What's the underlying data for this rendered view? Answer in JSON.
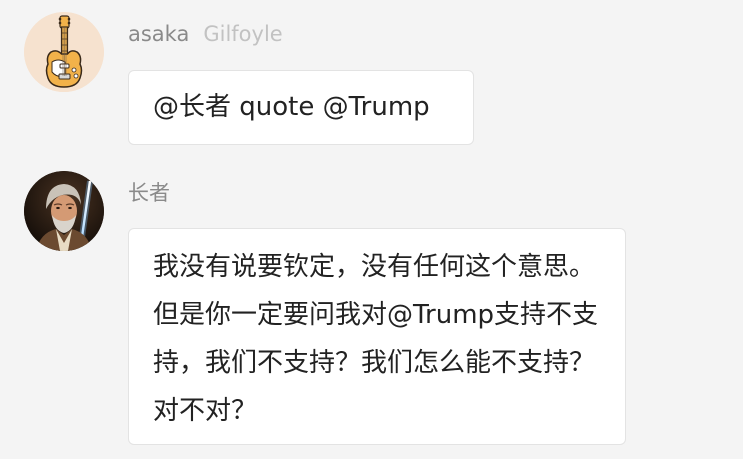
{
  "chat": {
    "messages": [
      {
        "sender": "asaka",
        "sender_tag": "Gilfoyle",
        "avatar_icon": "electric-guitar-icon",
        "text": "@长者 quote @Trump"
      },
      {
        "sender": "长者",
        "sender_tag": "",
        "avatar_icon": "jedi-portrait-avatar",
        "text": "我没有说要钦定，没有任何这个意思。但是你一定要问我对@Trump支持不支持，我们不支持？我们怎么能不支持？对不对？"
      }
    ]
  },
  "colors": {
    "background": "#f4f4f4",
    "bubble": "#ffffff",
    "bubble_border": "#e3e3e3",
    "sender_name": "#8a8a8a",
    "sender_tag": "#c2c2c2",
    "message_text": "#222222"
  }
}
